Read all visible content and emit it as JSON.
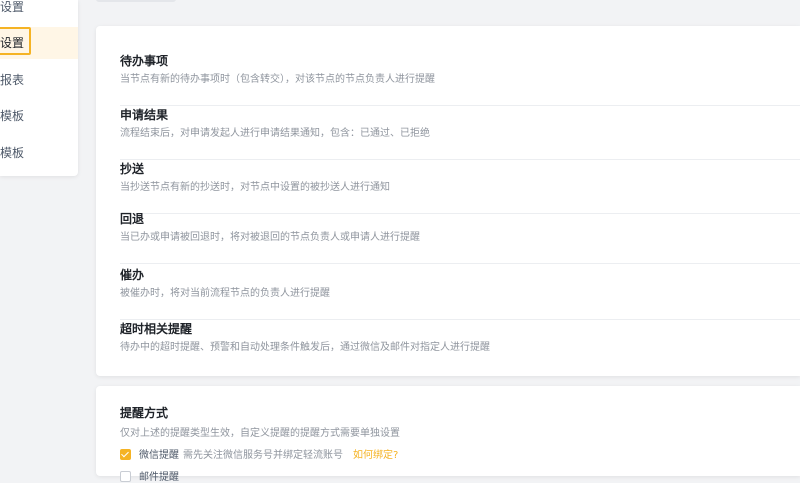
{
  "sidebar": {
    "items": [
      {
        "label": "设置"
      },
      {
        "label": "设置"
      },
      {
        "label": "报表"
      },
      {
        "label": "模板"
      },
      {
        "label": "模板"
      }
    ]
  },
  "notification_types": [
    {
      "title": "待办事项",
      "desc": "当节点有新的待办事项时（包含转交），对该节点的节点负责人进行提醒"
    },
    {
      "title": "申请结果",
      "desc": "流程结束后，对申请发起人进行申请结果通知，包含：已通过、已拒绝"
    },
    {
      "title": "抄送",
      "desc": "当抄送节点有新的抄送时，对节点中设置的被抄送人进行通知"
    },
    {
      "title": "回退",
      "desc": "当已办或申请被回退时，将对被退回的节点负责人或申请人进行提醒"
    },
    {
      "title": "催办",
      "desc": "被催办时，将对当前流程节点的负责人进行提醒"
    },
    {
      "title": "超时相关提醒",
      "desc": "待办中的超时提醒、预警和自动处理条件触发后，通过微信及邮件对指定人进行提醒"
    }
  ],
  "reminder_method": {
    "title": "提醒方式",
    "desc": "仅对上述的提醒类型生效，自定义提醒的提醒方式需要单独设置",
    "wechat": {
      "label": "微信提醒",
      "hint": "需先关注微信服务号并绑定轻流账号",
      "link": "如何绑定?",
      "checked": true
    },
    "email": {
      "label": "邮件提醒",
      "checked": false
    }
  },
  "colors": {
    "accent": "#f5b324",
    "text_primary": "#1f2329",
    "text_secondary": "#8f959e"
  }
}
